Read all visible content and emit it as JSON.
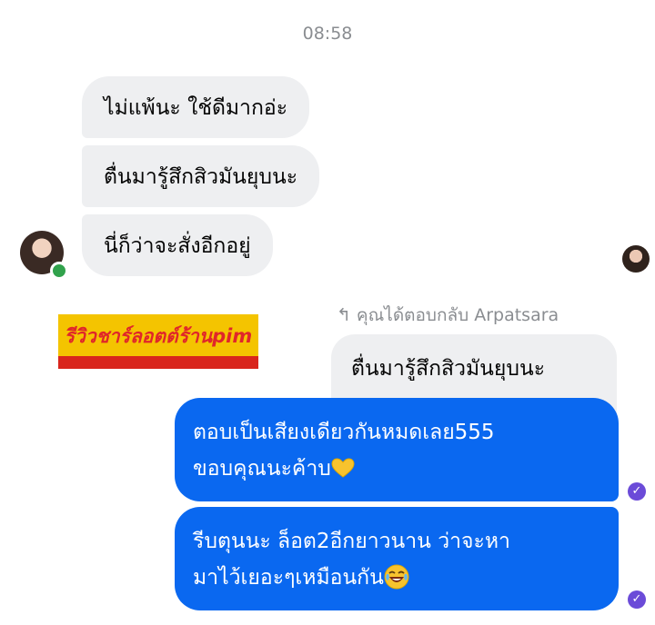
{
  "chat": {
    "time": "08:58",
    "incoming": [
      "ไม่แพ้นะ ใช้ดีมากอ่ะ",
      "ตื่นมารู้สึกสิวมันยุบนะ",
      "นี่ก็ว่าจะสั่งอีกอยู่"
    ],
    "watermark": "รีวิวชาร์ลอตต์ร้านpim",
    "reply": {
      "arrow": "↰",
      "label": "คุณได้ตอบกลับ Arpatsara",
      "quoted": "ตื่นมารู้สึกสิวมันยุบนะ"
    },
    "outgoing": [
      {
        "line1": "ตอบเป็นเสียงเดียวกันหมดเลย555",
        "line2": "ขอบคุณนะค้าบ",
        "emoji": "yellow-heart"
      },
      {
        "line1": "รีบตุนนะ ล็อต2อีกยาวนาน ว่าจะหา",
        "line2": "มาไว้เยอะๆเหมือนกัน",
        "emoji": "tears-of-joy"
      }
    ],
    "seen_mark": "✓"
  },
  "colors": {
    "outgoing_bubble": "#0a68f0",
    "incoming_bubble": "#eeeff1",
    "online": "#31a24c",
    "seen": "#6b4bd8"
  }
}
